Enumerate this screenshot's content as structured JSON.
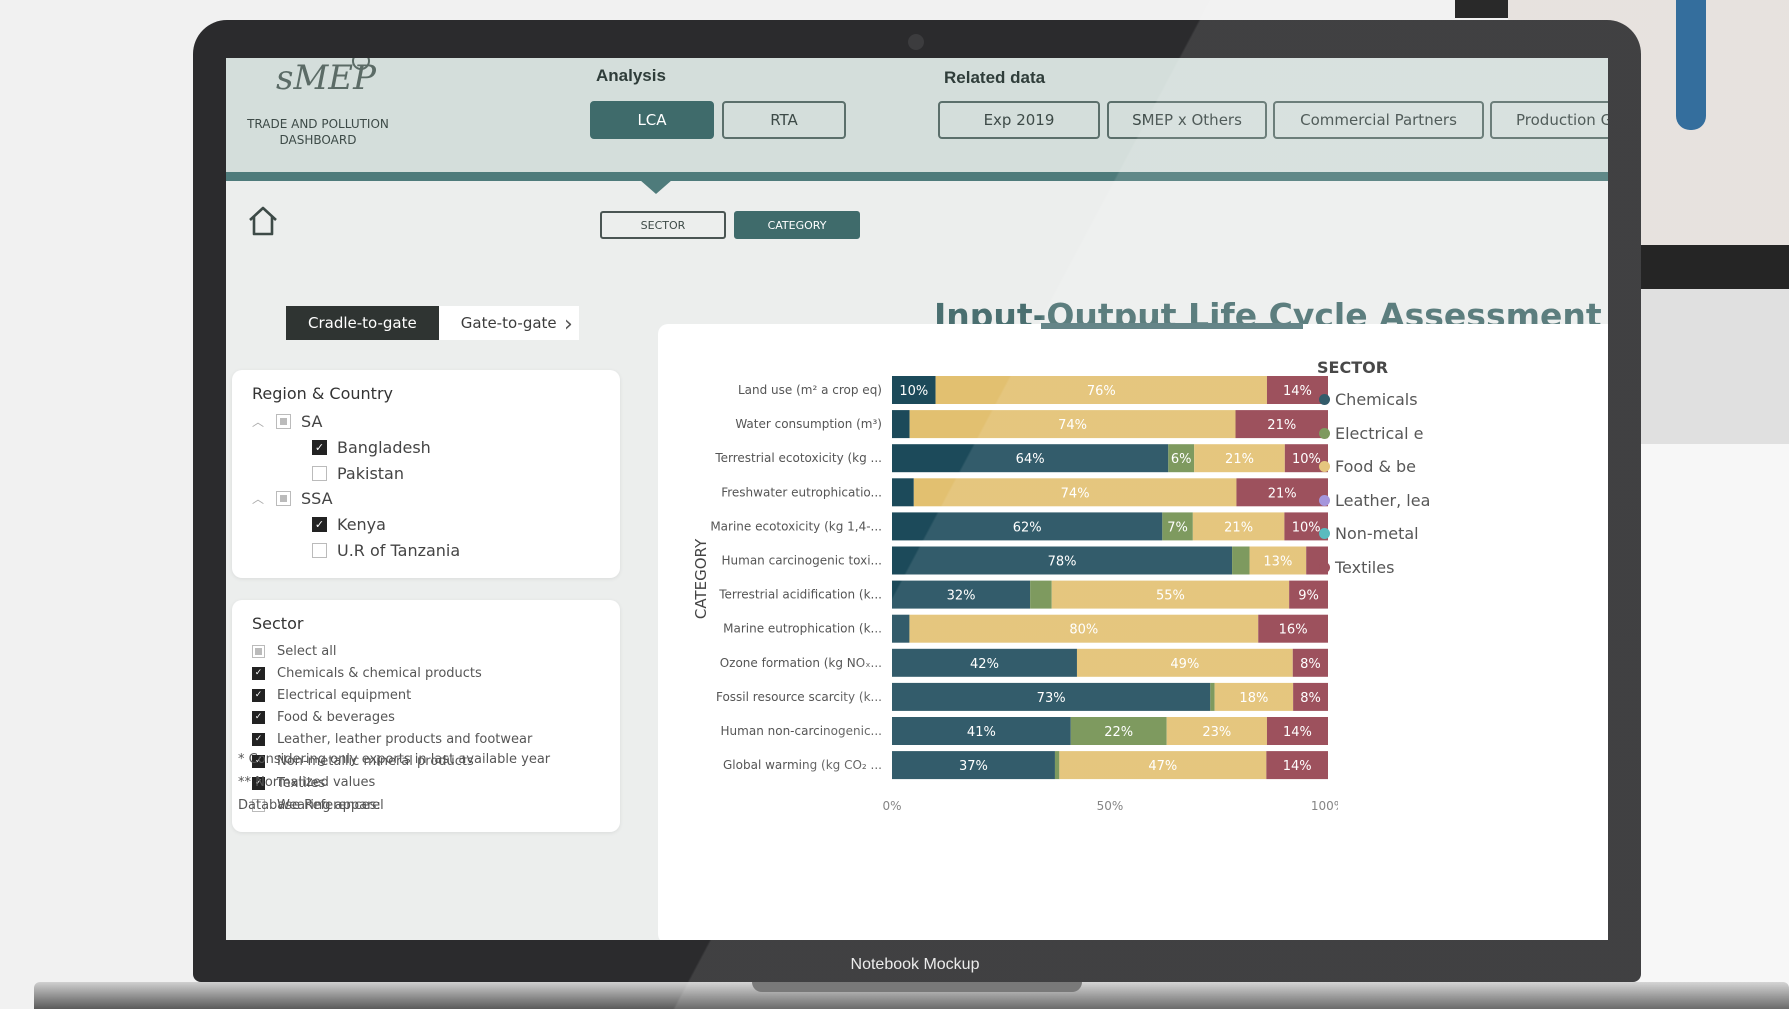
{
  "header": {
    "logo_text": "sMEP",
    "app_title_line1": "TRADE AND POLLUTION",
    "app_title_line2": "DASHBOARD",
    "analysis_label": "Analysis",
    "analysis_tabs": [
      {
        "label": "LCA",
        "active": true
      },
      {
        "label": "RTA",
        "active": false
      }
    ],
    "related_label": "Related data",
    "related_tabs": [
      {
        "label": "Exp 2019"
      },
      {
        "label": "SMEP x Others"
      },
      {
        "label": "Commercial Partners"
      },
      {
        "label": "Production G"
      }
    ]
  },
  "view_toggle": {
    "sector": "SECTOR",
    "category": "CATEGORY",
    "active": "CATEGORY"
  },
  "scope_tabs": {
    "cradle": "Cradle-to-gate",
    "gate": "Gate-to-gate",
    "active": "Cradle-to-gate"
  },
  "title": "Input-Output Life Cycle Assessment (IO-LC",
  "region_filter": {
    "title": "Region & Country",
    "groups": [
      {
        "label": "SA",
        "items": [
          {
            "label": "Bangladesh",
            "checked": true
          },
          {
            "label": "Pakistan",
            "checked": false
          }
        ]
      },
      {
        "label": "SSA",
        "items": [
          {
            "label": "Kenya",
            "checked": true
          },
          {
            "label": "U.R of Tanzania",
            "checked": false
          }
        ]
      }
    ]
  },
  "sector_filter": {
    "title": "Sector",
    "items": [
      {
        "label": "Select all",
        "state": "partial"
      },
      {
        "label": "Chemicals & chemical products",
        "state": "checked"
      },
      {
        "label": "Electrical equipment",
        "state": "checked"
      },
      {
        "label": "Food & beverages",
        "state": "checked"
      },
      {
        "label": "Leather, leather products and footwear",
        "state": "checked"
      },
      {
        "label": "Non-metallic mineral products",
        "state": "checked"
      },
      {
        "label": "Textiles",
        "state": "checked"
      },
      {
        "label": "Wearing apparel",
        "state": "unchecked"
      }
    ]
  },
  "notes": {
    "line1": "* Considering only exports in last available year",
    "line2": "** Normalized values",
    "line3": "Database References:"
  },
  "caption": "Notebook Mockup",
  "colors": {
    "Chemicals": "#1c4a5a",
    "Electrical": "#6f8f4d",
    "Food": "#e2c070",
    "Leather": "#9b8ad8",
    "Non-metallic": "#46b3b8",
    "Textiles": "#923d4b"
  },
  "chart_data": {
    "type": "bar",
    "orientation": "horizontal",
    "stacked": "100%",
    "ylabel": "CATEGORY",
    "legend_title": "SECTOR",
    "legend_position": "right",
    "xticks": [
      "0%",
      "50%",
      "100%"
    ],
    "xlim": [
      0,
      100
    ],
    "categories": [
      "Land use (m² a crop eq)",
      "Water consumption (m³)",
      "Terrestrial ecotoxicity (kg ...",
      "Freshwater eutrophicatio...",
      "Marine ecotoxicity (kg 1,4-...",
      "Human carcinogenic toxi...",
      "Terrestrial acidification (k...",
      "Marine eutrophication (k...",
      "Ozone formation (kg NOₓ...",
      "Fossil resource scarcity (k...",
      "Human non-carcinogenic...",
      "Global warming (kg CO₂ ..."
    ],
    "series": [
      {
        "name": "Chemicals",
        "color_key": "Chemicals",
        "values": [
          10,
          4,
          64,
          5,
          62,
          78,
          32,
          4,
          42,
          73,
          41,
          37
        ]
      },
      {
        "name": "Electrical",
        "color_key": "Electrical",
        "values": [
          0,
          0,
          6,
          0,
          7,
          4,
          5,
          0,
          0,
          1,
          22,
          1
        ]
      },
      {
        "name": "Food",
        "color_key": "Food",
        "values": [
          76,
          74,
          21,
          74,
          21,
          13,
          55,
          80,
          49,
          18,
          23,
          47
        ]
      },
      {
        "name": "Textiles",
        "color_key": "Textiles",
        "values": [
          14,
          21,
          10,
          21,
          10,
          5,
          9,
          16,
          8,
          8,
          14,
          14
        ]
      }
    ],
    "data_labels": [
      [
        "10%",
        "",
        "76%",
        "14%"
      ],
      [
        "",
        "",
        "74%",
        "21%"
      ],
      [
        "64%",
        "6%",
        "21%",
        "10%"
      ],
      [
        "",
        "",
        "74%",
        "21%"
      ],
      [
        "62%",
        "7%",
        "21%",
        "10%"
      ],
      [
        "78%",
        "",
        "13%",
        ""
      ],
      [
        "32%",
        "",
        "55%",
        "9%"
      ],
      [
        "",
        "",
        "80%",
        "16%"
      ],
      [
        "42%",
        "",
        "49%",
        "8%"
      ],
      [
        "73%",
        "",
        "18%",
        "8%"
      ],
      [
        "41%",
        "22%",
        "23%",
        "14%"
      ],
      [
        "37%",
        "",
        "47%",
        "14%"
      ]
    ],
    "legend": [
      {
        "label": "Chemicals",
        "color_key": "Chemicals"
      },
      {
        "label": "Electrical e",
        "color_key": "Electrical"
      },
      {
        "label": "Food & be",
        "color_key": "Food"
      },
      {
        "label": "Leather, lea",
        "color_key": "Leather"
      },
      {
        "label": "Non-metal",
        "color_key": "Non-metallic"
      },
      {
        "label": "Textiles",
        "color_key": "Textiles"
      }
    ]
  }
}
